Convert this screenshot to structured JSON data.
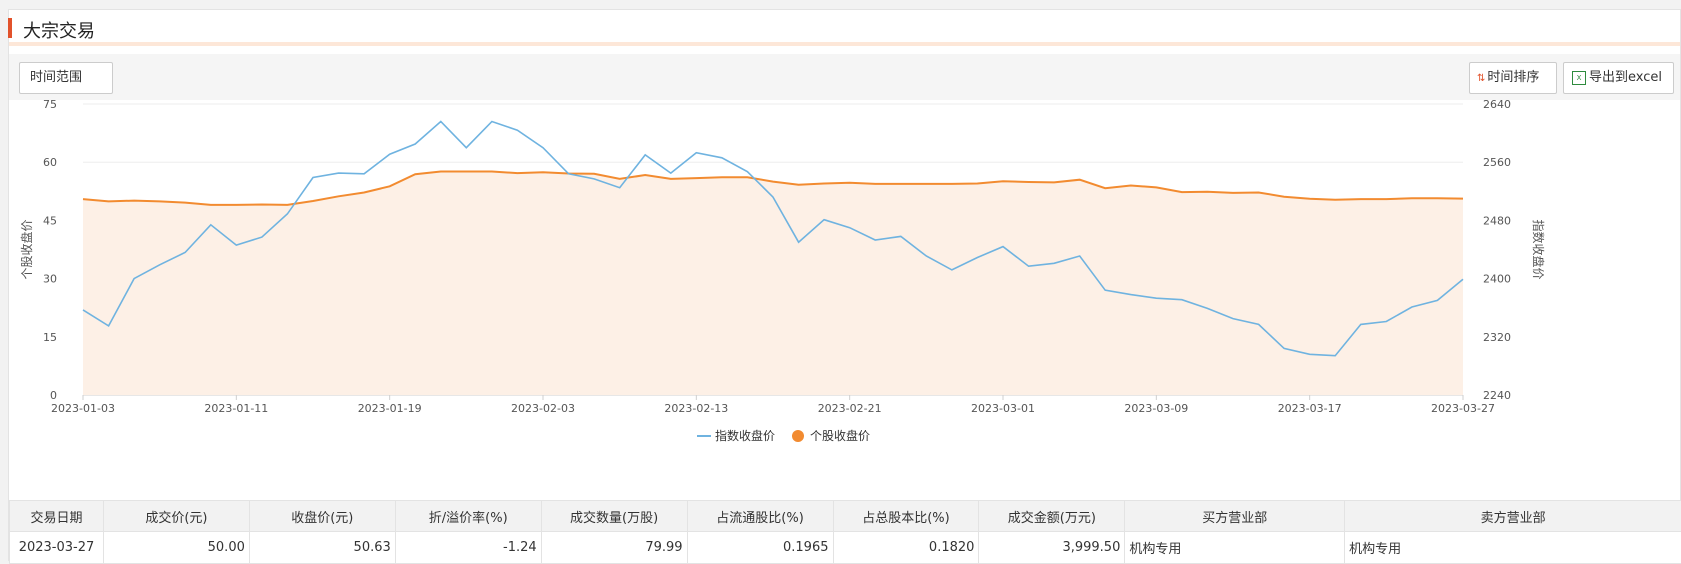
{
  "header": {
    "title": "大宗交易"
  },
  "toolbar": {
    "range_label": "时间范围",
    "sort_label": "时间排序",
    "sort_icon": "sort-arrows-icon",
    "export_label": "导出到excel",
    "export_icon": "excel-icon"
  },
  "chart_data": {
    "type": "line",
    "title": "",
    "ylabel_left": "个股收盘价",
    "ylabel_right": "指数收盘价",
    "y_left_ticks": [
      "0",
      "15",
      "30",
      "45",
      "60",
      "75"
    ],
    "y_right_ticks": [
      "2240",
      "2320",
      "2400",
      "2480",
      "2560",
      "2640"
    ],
    "ylim_left": [
      0,
      75
    ],
    "ylim_right": [
      2240,
      2640
    ],
    "x_tick_labels": [
      "2023-01-03",
      "2023-01-11",
      "2023-01-19",
      "2023-02-03",
      "2023-02-13",
      "2023-02-21",
      "2023-03-01",
      "2023-03-09",
      "2023-03-17",
      "2023-03-27"
    ],
    "colors": {
      "index": "#6fb3e0",
      "stock": "#f28b30",
      "stock_area": "#fdf0e6"
    },
    "legend_position": "bottom-center",
    "series": [
      {
        "name": "指数收盘价",
        "axis": "right",
        "values": [
          2357,
          2335,
          2400,
          2419,
          2436,
          2474,
          2446,
          2457,
          2489,
          2539,
          2545,
          2544,
          2571,
          2585,
          2616,
          2580,
          2616,
          2604,
          2580,
          2544,
          2537,
          2525,
          2570,
          2545,
          2573,
          2566,
          2547,
          2512,
          2450,
          2481,
          2470,
          2453,
          2458,
          2431,
          2412,
          2429,
          2444,
          2417,
          2421,
          2431,
          2384,
          2378,
          2373,
          2371,
          2359,
          2345,
          2337,
          2304,
          2296,
          2294,
          2337,
          2341,
          2361,
          2370,
          2399
        ]
      },
      {
        "name": "个股收盘价",
        "axis": "left",
        "values": [
          50.5,
          49.9,
          50.1,
          49.9,
          49.6,
          49.0,
          49.0,
          49.1,
          49.0,
          50.0,
          51.2,
          52.2,
          53.8,
          56.9,
          57.6,
          57.6,
          57.6,
          57.2,
          57.4,
          57.1,
          57.0,
          55.7,
          56.7,
          55.7,
          55.9,
          56.1,
          56.1,
          55.0,
          54.2,
          54.5,
          54.7,
          54.4,
          54.4,
          54.4,
          54.4,
          54.5,
          55.1,
          54.9,
          54.8,
          55.5,
          53.3,
          54.0,
          53.5,
          52.3,
          52.4,
          52.1,
          52.2,
          51.1,
          50.6,
          50.3,
          50.5,
          50.5,
          50.7,
          50.7,
          50.63
        ]
      }
    ]
  },
  "table": {
    "headers": [
      "交易日期",
      "成交价(元)",
      "收盘价(元)",
      "折/溢价率(%)",
      "成交数量(万股)",
      "占流通股比(%)",
      "占总股本比(%)",
      "成交金额(万元)",
      "买方营业部",
      "卖方营业部"
    ],
    "rows": [
      [
        "2023-03-27",
        "50.00",
        "50.63",
        "-1.24",
        "79.99",
        "0.1965",
        "0.1820",
        "3,999.50",
        "机构专用",
        "机构专用"
      ]
    ]
  }
}
